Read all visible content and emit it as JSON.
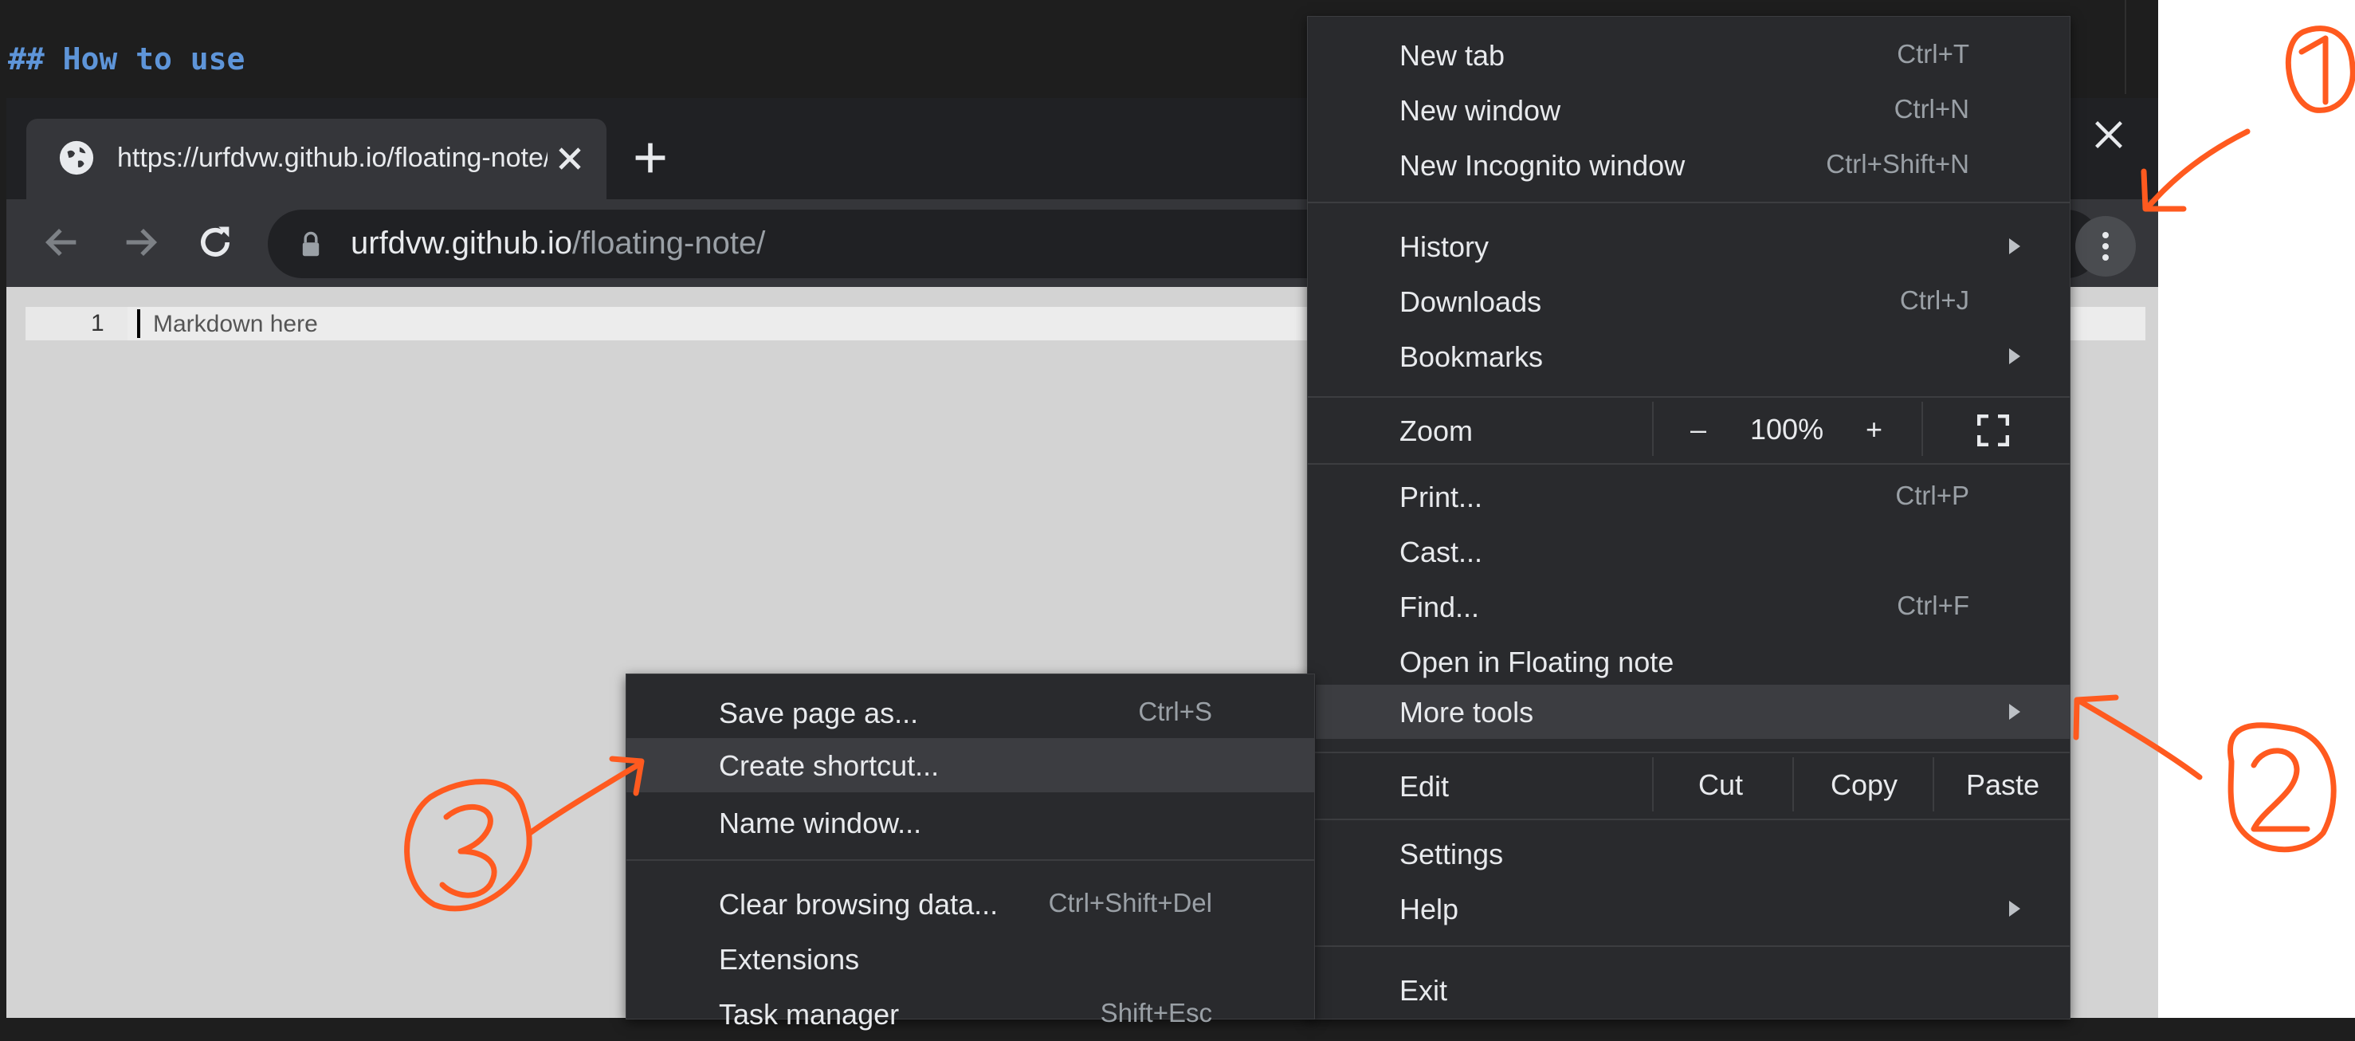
{
  "heading": "## How to use",
  "browser": {
    "tab_title": "https://urfdvw.github.io/floating-note/",
    "url_host": "urfdvw.github.io",
    "url_path": "/floating-note/"
  },
  "editor": {
    "line_number": "1",
    "placeholder": "Markdown here"
  },
  "menu": {
    "new_tab": {
      "label": "New tab",
      "shortcut": "Ctrl+T"
    },
    "new_window": {
      "label": "New window",
      "shortcut": "Ctrl+N"
    },
    "new_incognito": {
      "label": "New Incognito window",
      "shortcut": "Ctrl+Shift+N"
    },
    "history": {
      "label": "History"
    },
    "downloads": {
      "label": "Downloads",
      "shortcut": "Ctrl+J"
    },
    "bookmarks": {
      "label": "Bookmarks"
    },
    "zoom": {
      "label": "Zoom",
      "minus": "–",
      "value": "100%",
      "plus": "+"
    },
    "print": {
      "label": "Print...",
      "shortcut": "Ctrl+P"
    },
    "cast": {
      "label": "Cast..."
    },
    "find": {
      "label": "Find...",
      "shortcut": "Ctrl+F"
    },
    "open_floating": {
      "label": "Open in Floating note"
    },
    "more_tools": {
      "label": "More tools"
    },
    "edit": {
      "label": "Edit",
      "cut": "Cut",
      "copy": "Copy",
      "paste": "Paste"
    },
    "settings": {
      "label": "Settings"
    },
    "help": {
      "label": "Help"
    },
    "exit": {
      "label": "Exit"
    }
  },
  "submenu": {
    "save_page": {
      "label": "Save page as...",
      "shortcut": "Ctrl+S"
    },
    "create_shortcut": {
      "label": "Create shortcut..."
    },
    "name_window": {
      "label": "Name window..."
    },
    "clear_data": {
      "label": "Clear browsing data...",
      "shortcut": "Ctrl+Shift+Del"
    },
    "extensions": {
      "label": "Extensions"
    },
    "task_manager": {
      "label": "Task manager",
      "shortcut": "Shift+Esc"
    }
  },
  "annotations": {
    "one": "1",
    "two": "2",
    "three": "3"
  },
  "colors": {
    "annotation": "#ff5a1f",
    "menu_bg": "#292a2d",
    "highlight": "#3c3d41"
  }
}
